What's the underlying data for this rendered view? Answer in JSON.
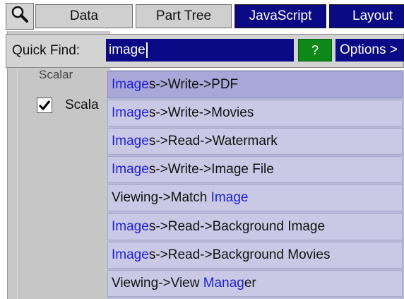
{
  "tabs": {
    "data": "Data",
    "part_tree": "Part Tree",
    "javascript": "JavaScript",
    "layout": "Layout"
  },
  "left_panel": {
    "hidden_label": "Scalar",
    "checkbox_label": "Scala",
    "checkbox_checked": true
  },
  "quick_find": {
    "label": "Quick Find:",
    "value": "image",
    "help_label": "?",
    "options_label": "Options >"
  },
  "results": [
    {
      "match": "Image",
      "rest": "s->Write->PDF"
    },
    {
      "match": "Image",
      "rest": "s->Write->Movies"
    },
    {
      "match": "Image",
      "rest": "s->Read->Watermark"
    },
    {
      "match": "Image",
      "rest": "s->Write->Image File"
    },
    {
      "prefix": "Viewing->Match ",
      "match": "Image",
      "rest": ""
    },
    {
      "match": "Image",
      "rest": "s->Read->Background Image"
    },
    {
      "match": "Image",
      "rest": "s->Read->Background Movies"
    },
    {
      "prefix": "Viewing->View ",
      "match": "Manag",
      "rest": "er"
    }
  ],
  "colors": {
    "active_tab": "#0a0a86",
    "dropdown_item": "#c9c9e6",
    "dropdown_selected": "#a8a8d8",
    "match_highlight": "#2020d8",
    "help_button": "#0f8a1a"
  }
}
